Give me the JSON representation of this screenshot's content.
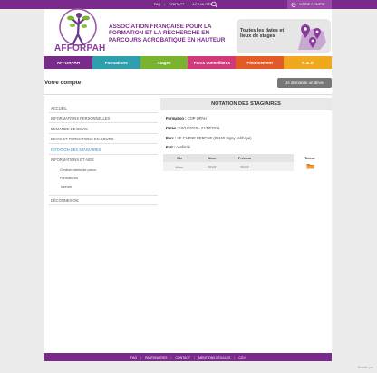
{
  "topbar": {
    "links": [
      "FAQ",
      "CONTACT",
      "ACTUALITÉS"
    ],
    "account_label": "VOTRE COMPTE",
    "color": "#7a2a8a"
  },
  "header": {
    "logo_text": "AFFORPAH",
    "headline": "ASSOCIATION FRANÇAISE POUR LA FORMATION ET LA RECHERCHE EN PARCOURS ACROBATIQUE EN HAUTEUR",
    "promo_text": "Toutes les dates et lieux de stages"
  },
  "menu": [
    {
      "label": "AFFORPAH",
      "color": "#7a2a8a"
    },
    {
      "label": "Formations",
      "color": "#2f9fb0"
    },
    {
      "label": "Stages",
      "color": "#7ab32e"
    },
    {
      "label": "Parcs conseillants",
      "color": "#d03a7a"
    },
    {
      "label": "Financement",
      "color": "#e25a25"
    },
    {
      "label": "R & D",
      "color": "#f0a81e"
    }
  ],
  "page": {
    "title": "Votre compte",
    "devis_button": "Je demande un devis"
  },
  "sidebar": {
    "items": [
      {
        "label": "ACCUEIL"
      },
      {
        "label": "INFORMATIONS PERSONNELLES"
      },
      {
        "label": "DEMANDE DE DEVIS"
      },
      {
        "label": "DEVIS ET FORMATIONS EN COURS"
      },
      {
        "label": "NOTATION DES STAGIAIRES"
      },
      {
        "label": "INFORMATIONS ET AIDE"
      }
    ],
    "subitems": [
      {
        "label": "Gestionnaires de parcs"
      },
      {
        "label": "Formateurs"
      },
      {
        "label": "Tuteurs"
      }
    ],
    "last_item": "DÉCONNEXION"
  },
  "main": {
    "heading": "NOTATION DES STAGIAIRES",
    "formation_label": "Formation :",
    "formation_value": "COP OPAH",
    "dates_label": "Dates :",
    "dates_value": "19/10/2015 - 21/10/2015",
    "parc_label": "Parc :",
    "parc_value": "LE CHENE PERCHE (08460 Signy l'Abbaye)",
    "etat_label": "Etat :",
    "etat_value": "confirmé",
    "table": {
      "headers": [
        "Civ",
        "Nom",
        "Prénom",
        "",
        "Tuteur"
      ],
      "row": [
        "Mme",
        "TEST",
        "TEST",
        ""
      ]
    }
  },
  "footer": {
    "links": [
      "FAQ",
      "PARTENAIRES",
      "CONTACT",
      "MENTIONS LÉGALES",
      "CGV"
    ]
  },
  "credit": "Réalisé par"
}
